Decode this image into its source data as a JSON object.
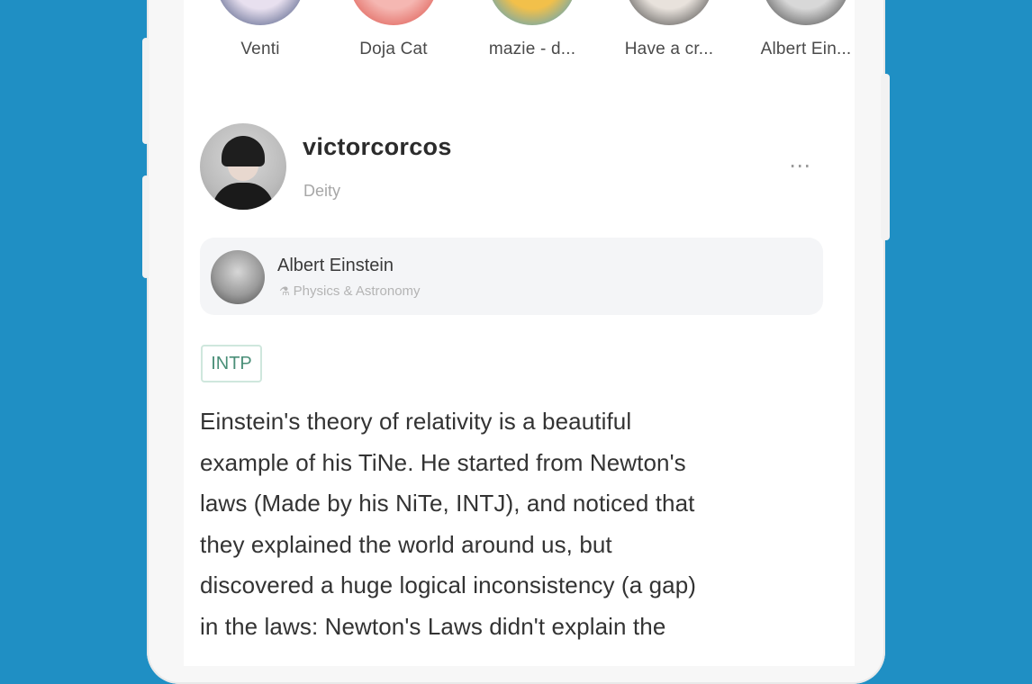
{
  "stories": [
    {
      "label": "Venti",
      "colors": [
        "#e8e0ef",
        "#2a3b6a"
      ]
    },
    {
      "label": "Doja Cat",
      "colors": [
        "#f5b7b2",
        "#d8433a"
      ]
    },
    {
      "label": "mazie - d...",
      "colors": [
        "#f2c04a",
        "#2b9be0"
      ]
    },
    {
      "label": "Have a cr...",
      "colors": [
        "#e8e2dc",
        "#2a2a2a"
      ]
    },
    {
      "label": "Albert Ein...",
      "colors": [
        "#d8d8d8",
        "#2c2c2c"
      ]
    }
  ],
  "post": {
    "username": "victorcorcos",
    "rank": "Deity",
    "more_icon": "⋯",
    "ref_profile": {
      "name": "Albert Einstein",
      "category": "Physics & Astronomy"
    },
    "tag": "INTP",
    "lines": [
      "Einstein's theory of relativity is a beautiful",
      "example of his TiNe. He started from Newton's",
      "laws (Made by his NiTe, INTJ), and noticed that",
      "they explained the world around us, but",
      "discovered a huge logical inconsistency (a gap)",
      "in the laws: Newton's Laws didn't explain the"
    ]
  },
  "colors": {
    "background": "#1f8fc4",
    "tag_border": "#cfe7dd",
    "tag_text": "#4a8f78"
  }
}
